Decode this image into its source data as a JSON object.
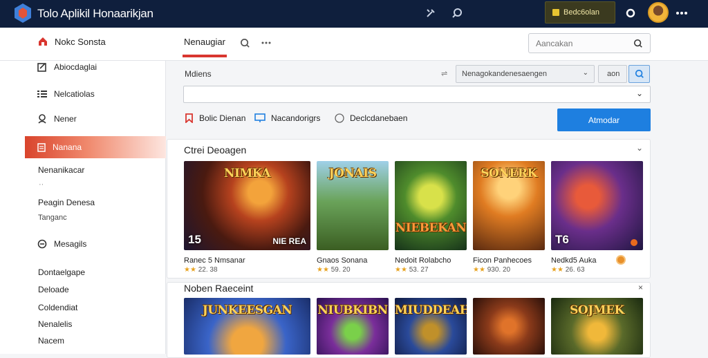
{
  "colors": {
    "topbar": "#0f1f3d",
    "accent": "#d9362f",
    "primary": "#1e7fe0",
    "star": "#e7a321"
  },
  "app": {
    "title": "Tolo Aplikil Honaarikjan",
    "pro_label": "Bedc6olan"
  },
  "subbar": {
    "home_label": "Nokc Sonsta",
    "tab_label": "Nenaugiar",
    "search_placeholder": "Aancakan"
  },
  "sidebar": {
    "items": [
      {
        "label": "Abiocdaglai",
        "icon": "edit-icon"
      },
      {
        "label": "Nelcatiolas",
        "icon": "list-icon"
      },
      {
        "label": "Nener",
        "icon": "user-icon"
      },
      {
        "label": "Nanana",
        "icon": "page-icon",
        "active": true
      }
    ],
    "links": [
      "Nenanikacar",
      "Peagin Denesa",
      "Mesagils"
    ],
    "sub_texts": [
      "Tanganc"
    ],
    "bottom_links": [
      "Dontaelgape",
      "Deloade",
      "Coldendiat",
      "Nenalelis",
      "Nacem"
    ]
  },
  "filters": {
    "label": "Mdiens",
    "select_label": "Nenagokandenesaengen",
    "small_select": "aon",
    "options": [
      {
        "label": "Bolic Dienan",
        "icon": "bookmark-icon"
      },
      {
        "label": "Nacandorigrs",
        "icon": "screen-icon"
      },
      {
        "label": "Declcdanebaen",
        "icon": "radio-icon"
      }
    ],
    "apply_label": "Atmodar"
  },
  "section1": {
    "title": "Ctrei Deoagen",
    "cards": [
      {
        "name": "Ranec 5 Nmsanar",
        "rating": "22. 38",
        "thumb_text": "NIMKA",
        "badge": "15",
        "caption": "NIE REA"
      },
      {
        "name": "Gnaos Sonana",
        "rating": "59. 20",
        "thumb_text": "JONAIS",
        "badge": "",
        "caption": ""
      },
      {
        "name": "Nedoit Rolabcho",
        "rating": "53. 27",
        "thumb_text": "NIEBEKAN",
        "badge": "",
        "caption": ""
      },
      {
        "name": "Ficon Panhecoes",
        "rating": "930. 20",
        "thumb_text": "SONERK",
        "badge": "",
        "caption": ""
      },
      {
        "name": "Nedkd5 Auka",
        "rating": "26. 63",
        "thumb_text": "",
        "badge": "T6",
        "caption": ""
      }
    ]
  },
  "section2": {
    "title": "Noben Raeceint",
    "cards": [
      {
        "thumb_text": "JUNKEESGAN"
      },
      {
        "thumb_text": "NIUBKIBN"
      },
      {
        "thumb_text": "MIUDDEAH"
      },
      {
        "thumb_text": ""
      },
      {
        "thumb_text": "SOJMEK"
      }
    ]
  }
}
